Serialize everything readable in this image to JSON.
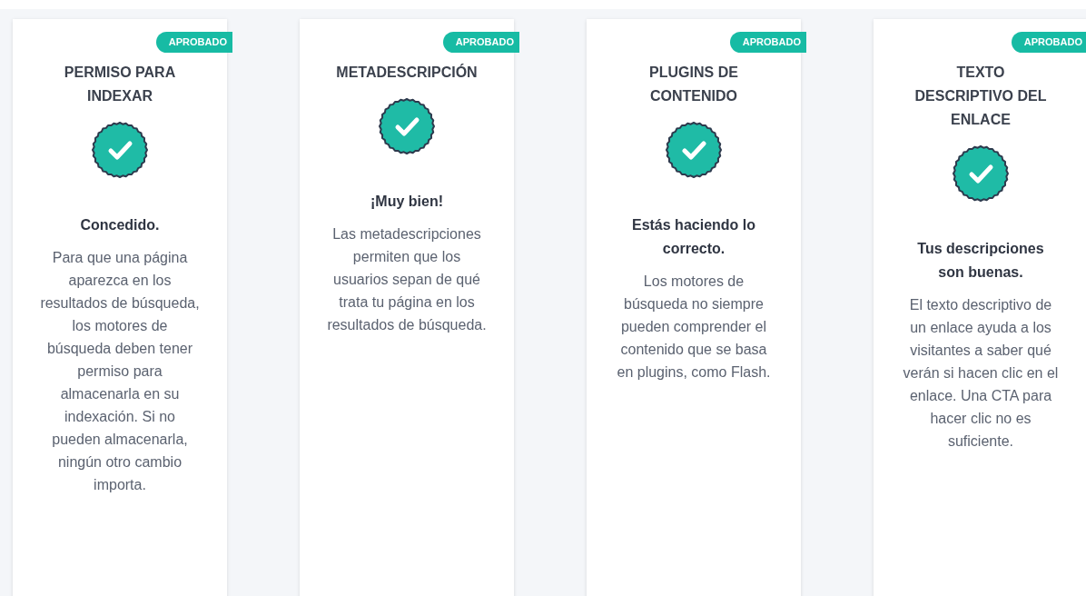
{
  "cards": [
    {
      "badge": "APROBADO",
      "title": "PERMISO PARA INDEXAR",
      "heading": "Concedido.",
      "text": "Para que una página aparezca en los resultados de búsqueda, los motores de búsqueda deben tener permiso para almacenarla en su indexación. Si no pueden almacenarla, ningún otro cambio importa."
    },
    {
      "badge": "APROBADO",
      "title": "METADESCRIPCIÓN",
      "heading": "¡Muy bien!",
      "text": "Las metadescripciones permiten que los usuarios sepan de qué trata tu página en los resultados de búsqueda."
    },
    {
      "badge": "APROBADO",
      "title": "PLUGINS DE CONTENIDO",
      "heading": "Estás haciendo lo correcto.",
      "text": "Los motores de búsqueda no siempre pueden comprender el contenido que se basa en plugins, como Flash."
    },
    {
      "badge": "APROBADO",
      "title": "TEXTO DESCRIPTIVO DEL ENLACE",
      "heading": "Tus descripciones son buenas.",
      "text": "El texto descriptivo de un enlace ayuda a los visitantes a saber qué verán si hacen clic en el enlace. Una CTA para hacer clic no es suficiente."
    }
  ]
}
